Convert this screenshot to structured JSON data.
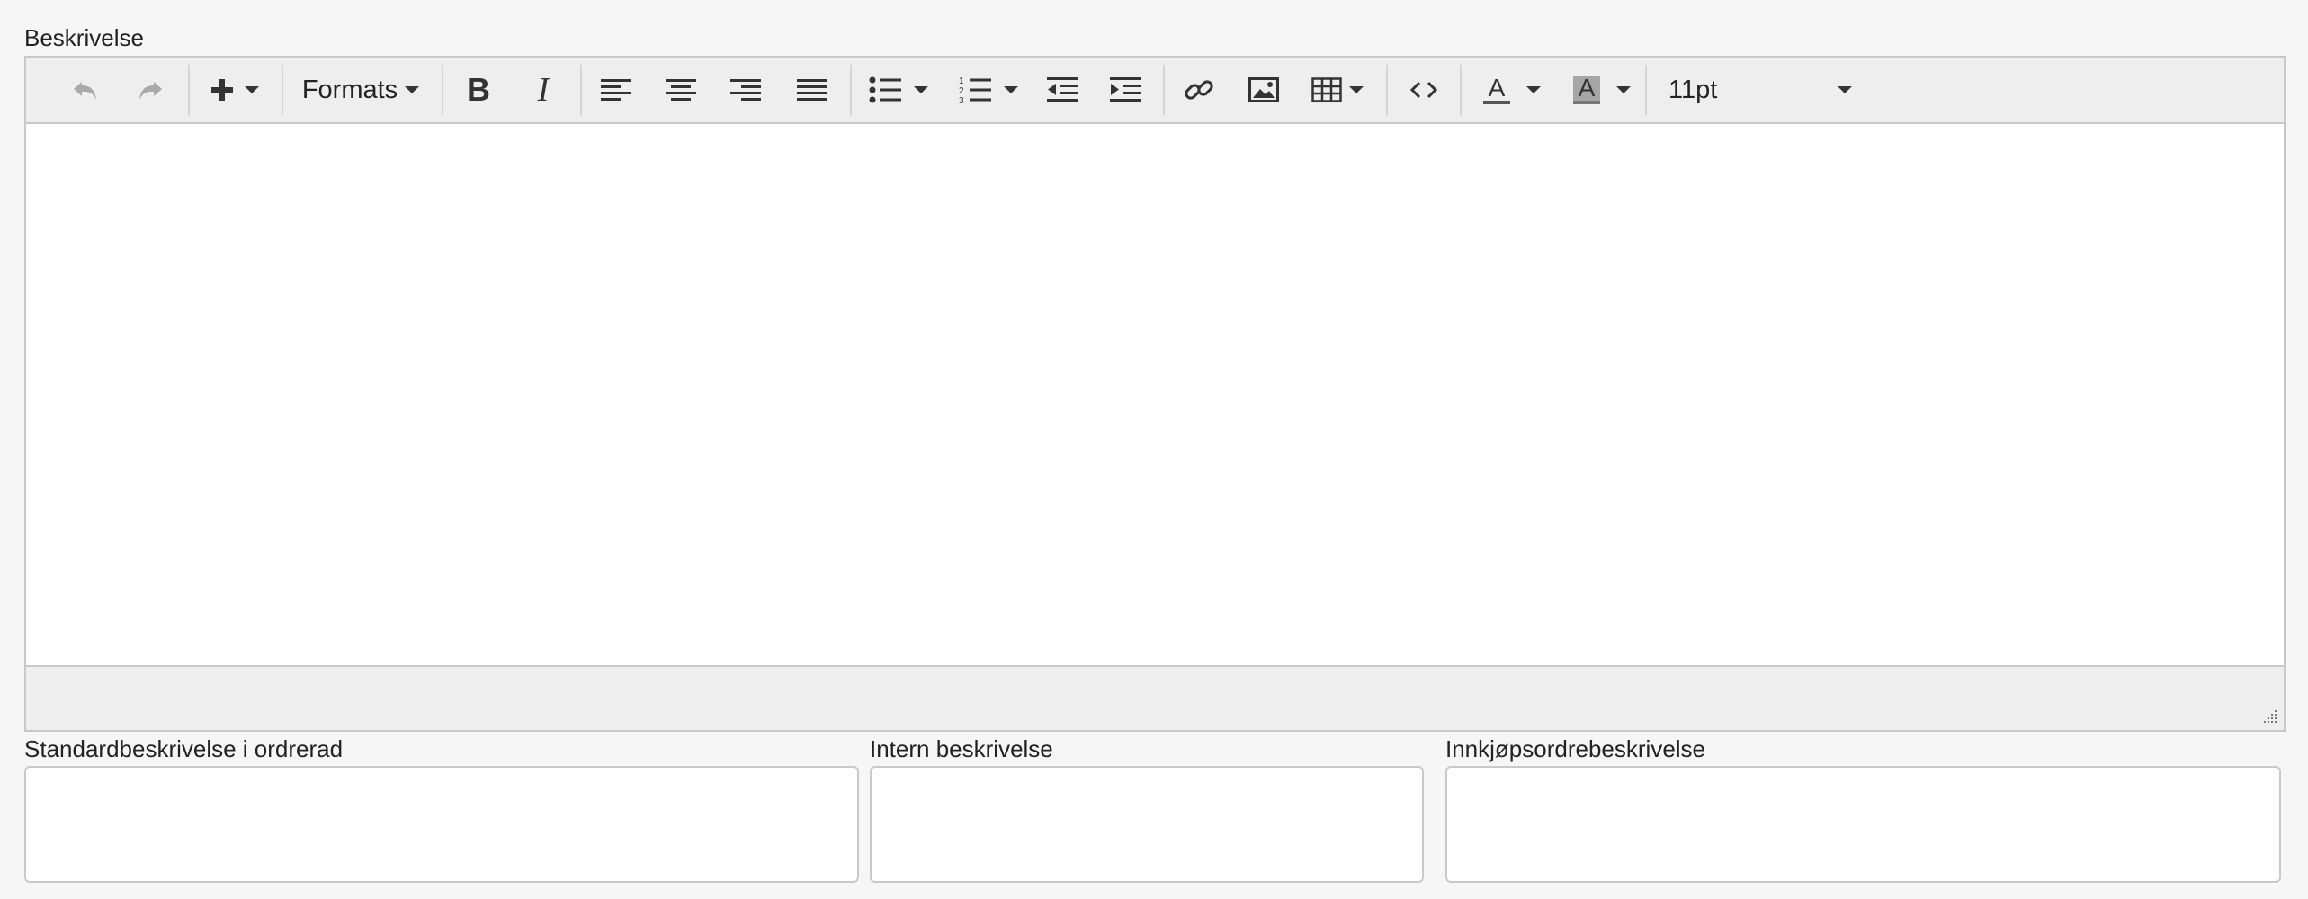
{
  "description_label": "Beskrivelse",
  "toolbar": {
    "undo_icon": "undo-icon",
    "redo_icon": "redo-icon",
    "insert_icon": "plus-icon",
    "formats_label": "Formats",
    "bold_icon": "bold-icon",
    "italic_icon": "italic-icon",
    "align_left_icon": "align-left-icon",
    "align_center_icon": "align-center-icon",
    "align_right_icon": "align-right-icon",
    "align_justify_icon": "align-justify-icon",
    "bullet_list_icon": "bullet-list-icon",
    "numbered_list_icon": "numbered-list-icon",
    "outdent_icon": "outdent-icon",
    "indent_icon": "indent-icon",
    "link_icon": "link-icon",
    "image_icon": "image-icon",
    "table_icon": "table-icon",
    "code_icon": "code-icon",
    "text_color_icon": "text-color-icon",
    "background_color_icon": "background-color-icon",
    "font_size_value": "11pt"
  },
  "fields": {
    "standard_label": "Standardbeskrivelse i ordrerad",
    "standard_value": "",
    "internal_label": "Intern beskrivelse",
    "internal_value": "",
    "purchase_label": "Innkjøpsordrebeskrivelse",
    "purchase_value": ""
  },
  "colors": {
    "toolbar_bg": "#eeeeee",
    "border": "#c8c8c8",
    "page_bg": "#f6f6f6",
    "disabled_icon": "#a9a9a9"
  }
}
